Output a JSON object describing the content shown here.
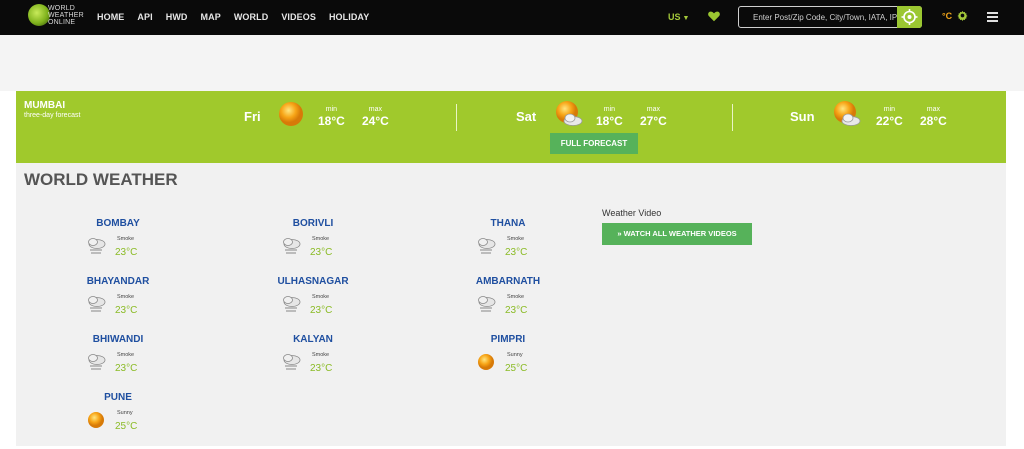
{
  "header": {
    "logo_lines": [
      "WORLD",
      "WEATHER",
      "ONLINE"
    ],
    "nav": [
      "HOME",
      "API",
      "HWD",
      "MAP",
      "WORLD",
      "VIDEOS",
      "HOLIDAY"
    ],
    "region": "US",
    "search_placeholder": "Enter Post/Zip Code, City/Town, IATA, IP",
    "unit": "°C",
    "accent": "#a0c92c"
  },
  "forecast": {
    "city": "MUMBAI",
    "subtitle": "three-day forecast",
    "days": [
      {
        "name": "Fri",
        "icon": "sunny-icon",
        "min_label": "min",
        "min": "18°C",
        "max_label": "max",
        "max": "24°C"
      },
      {
        "name": "Sat",
        "icon": "partly-cloudy-icon",
        "min_label": "min",
        "min": "18°C",
        "max_label": "max",
        "max": "27°C"
      },
      {
        "name": "Sun",
        "icon": "partly-cloudy-icon",
        "min_label": "min",
        "min": "22°C",
        "max_label": "max",
        "max": "28°C"
      }
    ],
    "full_forecast": "FULL FORECAST"
  },
  "world": {
    "title": "WORLD WEATHER",
    "cities": [
      {
        "name": "BOMBAY",
        "condition": "Smoke",
        "temp": "23°C",
        "icon": "smoke-icon"
      },
      {
        "name": "BORIVLI",
        "condition": "Smoke",
        "temp": "23°C",
        "icon": "smoke-icon"
      },
      {
        "name": "THANA",
        "condition": "Smoke",
        "temp": "23°C",
        "icon": "smoke-icon"
      },
      {
        "name": "BHAYANDAR",
        "condition": "Smoke",
        "temp": "23°C",
        "icon": "smoke-icon"
      },
      {
        "name": "ULHASNAGAR",
        "condition": "Smoke",
        "temp": "23°C",
        "icon": "smoke-icon"
      },
      {
        "name": "AMBARNATH",
        "condition": "Smoke",
        "temp": "23°C",
        "icon": "smoke-icon"
      },
      {
        "name": "BHIWANDI",
        "condition": "Smoke",
        "temp": "23°C",
        "icon": "smoke-icon"
      },
      {
        "name": "KALYAN",
        "condition": "Smoke",
        "temp": "23°C",
        "icon": "smoke-icon"
      },
      {
        "name": "PIMPRI",
        "condition": "Sunny",
        "temp": "25°C",
        "icon": "sunny-icon"
      },
      {
        "name": "PUNE",
        "condition": "Sunny",
        "temp": "25°C",
        "icon": "sunny-icon"
      }
    ],
    "video_label": "Weather Video",
    "video_button": "» WATCH ALL WEATHER VIDEOS"
  }
}
